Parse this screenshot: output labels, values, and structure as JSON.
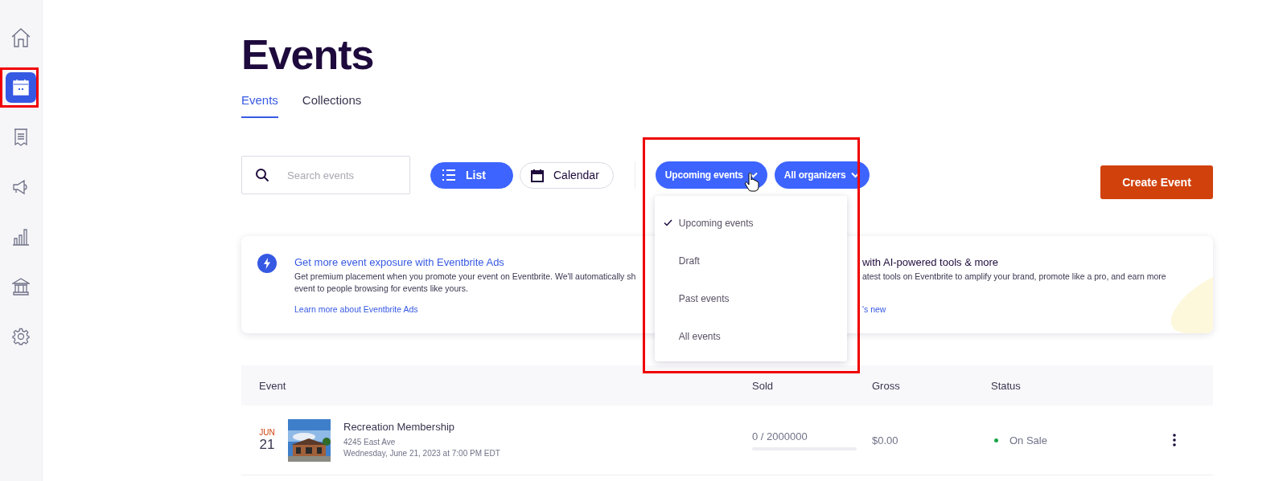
{
  "sidebar": {
    "items": [
      {
        "kind": "home",
        "selected": false
      },
      {
        "kind": "calendar",
        "selected": true
      },
      {
        "kind": "receipt",
        "selected": false
      },
      {
        "kind": "megaphone",
        "selected": false
      },
      {
        "kind": "chart",
        "selected": false
      },
      {
        "kind": "bank",
        "selected": false
      },
      {
        "kind": "gear",
        "selected": false
      }
    ]
  },
  "title": "Events",
  "tabs": [
    {
      "label": "Events",
      "selected": true
    },
    {
      "label": "Collections",
      "selected": false
    }
  ],
  "search": {
    "placeholder": "Search events"
  },
  "view_toggle": [
    {
      "label": "List",
      "kind": "list",
      "selected": true
    },
    {
      "label": "Calendar",
      "kind": "calendar",
      "selected": false
    }
  ],
  "filters": [
    {
      "label": "Upcoming events",
      "expanded": true
    },
    {
      "label": "All organizers",
      "expanded": false
    }
  ],
  "filter_menu": [
    {
      "label": "Upcoming events",
      "selected": true
    },
    {
      "label": "Draft",
      "selected": false
    },
    {
      "label": "Past events",
      "selected": false
    },
    {
      "label": "All events",
      "selected": false
    }
  ],
  "create_button": "Create Event",
  "promos": [
    {
      "title": "Get more event exposure with Eventbrite Ads",
      "lines": [
        "Get premium placement when you promote your event on Eventbrite. We'll automatically sh",
        "event to people browsing for events like yours."
      ],
      "link": "Learn more about Eventbrite Ads"
    },
    {
      "title": "with AI-powered tools & more",
      "lines": [
        "atest tools on Eventbrite to amplify your brand, promote like a pro, and earn more"
      ],
      "link": "'s new"
    }
  ],
  "table": {
    "columns": [
      "Event",
      "Sold",
      "Gross",
      "Status"
    ],
    "rows": [
      {
        "month": "JUN",
        "day": "21",
        "name": "Recreation Membership",
        "address": "4245 East Ave",
        "datetime": "Wednesday, June 21, 2023 at 7:00 PM EDT",
        "sold": "0 / 2000000",
        "level": 0,
        "gross": "$0.00",
        "status": "On Sale",
        "color": "#1aa64a"
      }
    ]
  }
}
